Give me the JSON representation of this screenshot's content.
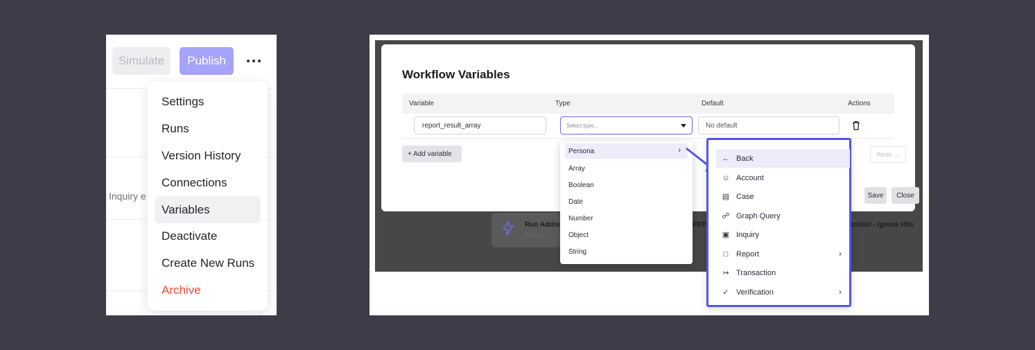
{
  "left": {
    "buttons": {
      "simulate": "Simulate",
      "publish": "Publish"
    },
    "background_text": "Inquiry e",
    "menu": [
      {
        "label": "Settings",
        "name": "menu-item-settings"
      },
      {
        "label": "Runs",
        "name": "menu-item-runs"
      },
      {
        "label": "Version History",
        "name": "menu-item-version-history"
      },
      {
        "label": "Connections",
        "name": "menu-item-connections"
      },
      {
        "label": "Variables",
        "name": "menu-item-variables",
        "active": true
      },
      {
        "label": "Deactivate",
        "name": "menu-item-deactivate"
      },
      {
        "label": "Create New Runs",
        "name": "menu-item-create-new-runs"
      },
      {
        "label": "Archive",
        "name": "menu-item-archive",
        "danger": true
      }
    ],
    "colors": {
      "publish": "#a6a3fb",
      "archive": "#ee4b36"
    }
  },
  "right": {
    "background": {
      "card_title": "Run Addre",
      "card_subtitle": "Action",
      "pep_fragment": "PEP",
      "watchlist_fragment": "atchlist - Ignore Hits"
    },
    "modal": {
      "title": "Workflow Variables",
      "columns": {
        "variable": "Variable",
        "type": "Type",
        "default": "Default",
        "actions": "Actions"
      },
      "row": {
        "variable": "report_result_array",
        "type_placeholder": "Select type...",
        "default_placeholder": "No default"
      },
      "add_button": "+ Add variable",
      "redo_button": "Redo →",
      "save_button": "Save",
      "close_button": "Close"
    },
    "type_options": [
      {
        "label": "Persona",
        "submenu": true,
        "highlighted": true
      },
      {
        "label": "Array"
      },
      {
        "label": "Boolean"
      },
      {
        "label": "Date"
      },
      {
        "label": "Number"
      },
      {
        "label": "Object"
      },
      {
        "label": "String"
      }
    ],
    "persona_menu": [
      {
        "label": "Back",
        "icon": "←",
        "icon_name": "arrow-left-icon",
        "highlighted": true
      },
      {
        "label": "Account",
        "icon": "☺",
        "icon_name": "account-icon"
      },
      {
        "label": "Case",
        "icon": "▤",
        "icon_name": "case-icon"
      },
      {
        "label": "Graph Query",
        "icon": "☍",
        "icon_name": "graph-query-icon"
      },
      {
        "label": "Inquiry",
        "icon": "▣",
        "icon_name": "inquiry-icon"
      },
      {
        "label": "Report",
        "icon": "□",
        "icon_name": "report-icon",
        "submenu": true
      },
      {
        "label": "Transaction",
        "icon": "↣",
        "icon_name": "transaction-icon"
      },
      {
        "label": "Verification",
        "icon": "✓",
        "icon_name": "verification-icon",
        "submenu": true
      }
    ],
    "colors": {
      "accent": "#5753e8",
      "highlight": "#ececfb"
    }
  }
}
